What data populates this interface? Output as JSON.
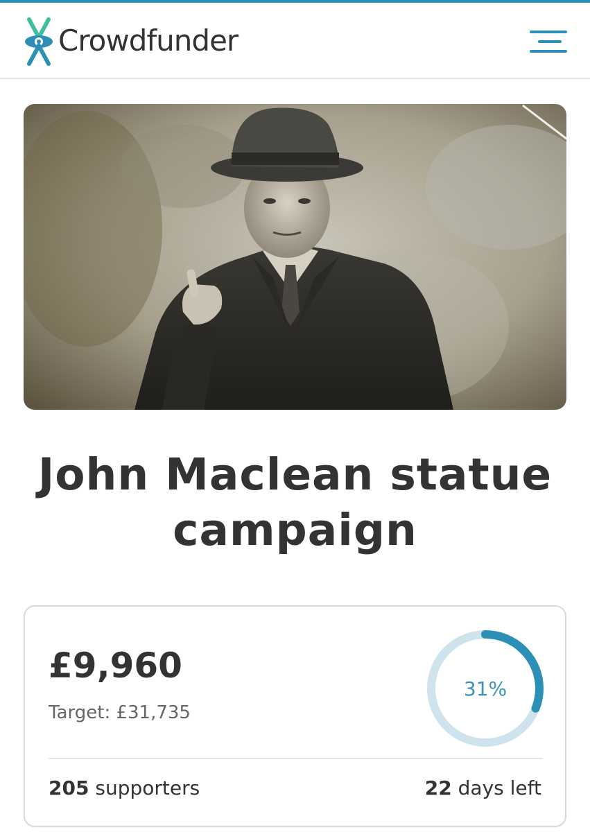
{
  "brand": {
    "name": "Crowdfunder",
    "colors": {
      "accent": "#2b8fb6",
      "logo_green": "#3fbf9f",
      "logo_blue": "#2b8fb6"
    }
  },
  "header": {
    "menu_icon": "hamburger-menu-icon"
  },
  "campaign": {
    "title": "John Maclean statue campaign",
    "raised": "£9,960",
    "target": "Target: £31,735",
    "percent_label": "31%",
    "percent_value": 0.31,
    "supporters_count": "205",
    "supporters_label": "supporters",
    "days_count": "22",
    "days_label": "days left"
  }
}
